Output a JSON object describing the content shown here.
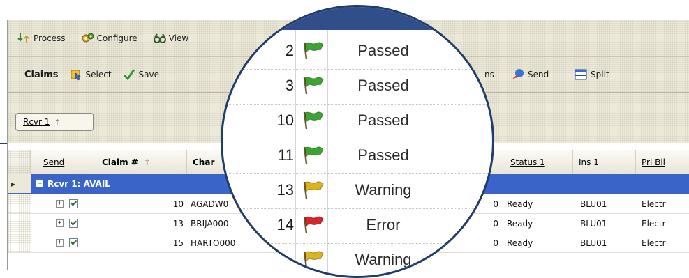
{
  "menu": [
    {
      "label": "Process",
      "icon": "process-icon"
    },
    {
      "label": "Configure",
      "icon": "configure-icon"
    },
    {
      "label": "View",
      "icon": "view-icon"
    }
  ],
  "toolbar": {
    "title": "Claims",
    "buttons": [
      {
        "label": "Select",
        "icon": "select-icon"
      },
      {
        "label": "Save",
        "icon": "save-check-icon"
      }
    ],
    "right_fragment": "ns",
    "send_label": "Send",
    "split_label": "Split"
  },
  "group_chip": {
    "label": "Rcvr 1",
    "sort": "↑"
  },
  "columns": {
    "send": "Send",
    "claim": "Claim #",
    "claim_sort": "↑",
    "charge": "Char",
    "status": "Status 1",
    "ins": "Ins 1",
    "pribill": "Pri Bil"
  },
  "group_row": {
    "label": "Rcvr 1: AVAIL"
  },
  "rows": [
    {
      "claim": "10",
      "charge": "AGADW0",
      "amount": "0",
      "status": "Ready",
      "ins": "BLU01",
      "pribill": "Electr"
    },
    {
      "claim": "13",
      "charge": "BRIJA000",
      "amount": "0",
      "status": "Ready",
      "ins": "BLU01",
      "pribill": "Electr"
    },
    {
      "claim": "15",
      "charge": "HARTO000",
      "amount": "0",
      "status": "Ready",
      "ins": "BLU01",
      "pribill": "Electr"
    }
  ],
  "lens_rows": [
    {
      "num": "2",
      "flag": "green",
      "status": "Passed"
    },
    {
      "num": "3",
      "flag": "green",
      "status": "Passed"
    },
    {
      "num": "10",
      "flag": "green",
      "status": "Passed"
    },
    {
      "num": "11",
      "flag": "green",
      "status": "Passed"
    },
    {
      "num": "13",
      "flag": "yellow",
      "status": "Warning"
    },
    {
      "num": "14",
      "flag": "red",
      "status": "Error"
    },
    {
      "num": "",
      "flag": "yellow",
      "status": "Warning"
    }
  ],
  "colors": {
    "green": "#3aa52f",
    "yellow": "#e0b21a",
    "red": "#d8242a",
    "group_blue": "#3a64c8",
    "lens_border": "#1f3c6b"
  }
}
